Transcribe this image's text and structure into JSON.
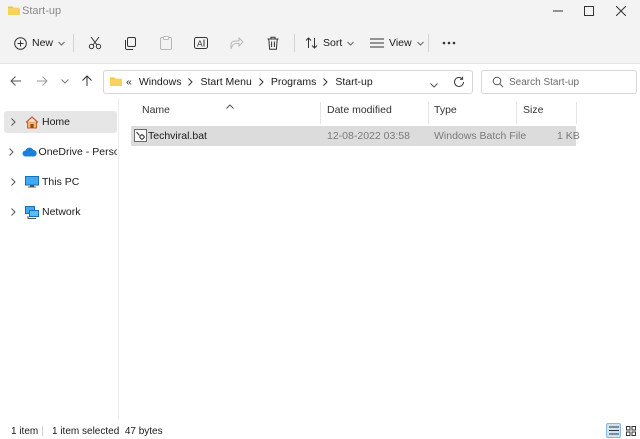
{
  "window": {
    "title": "Start-up"
  },
  "toolbar": {
    "new_label": "New",
    "sort_label": "Sort",
    "view_label": "View"
  },
  "address": {
    "overflow": "«",
    "crumbs": [
      "Windows",
      "Start Menu",
      "Programs",
      "Start-up"
    ]
  },
  "search": {
    "placeholder": "Search Start-up"
  },
  "sidebar": {
    "items": [
      {
        "label": "Home",
        "icon": "home-icon",
        "selected": true
      },
      {
        "label": "OneDrive - Personal",
        "icon": "onedrive-icon"
      },
      {
        "label": "This PC",
        "icon": "this-pc-icon"
      },
      {
        "label": "Network",
        "icon": "network-icon"
      }
    ]
  },
  "columns": {
    "name": "Name",
    "date": "Date modified",
    "type": "Type",
    "size": "Size"
  },
  "files": [
    {
      "name": "Techviral.bat",
      "date": "12-08-2022 03:58",
      "type": "Windows Batch File",
      "size": "1 KB",
      "icon": "batch-file-icon",
      "selected": true
    }
  ],
  "status": {
    "count": "1 item",
    "selected": "1 item selected  47 bytes"
  },
  "colors": {
    "chrome": "#f3f3f3",
    "selection": "#dcdcdc",
    "accent": "#0067c0",
    "folder": "#f4c13d"
  }
}
